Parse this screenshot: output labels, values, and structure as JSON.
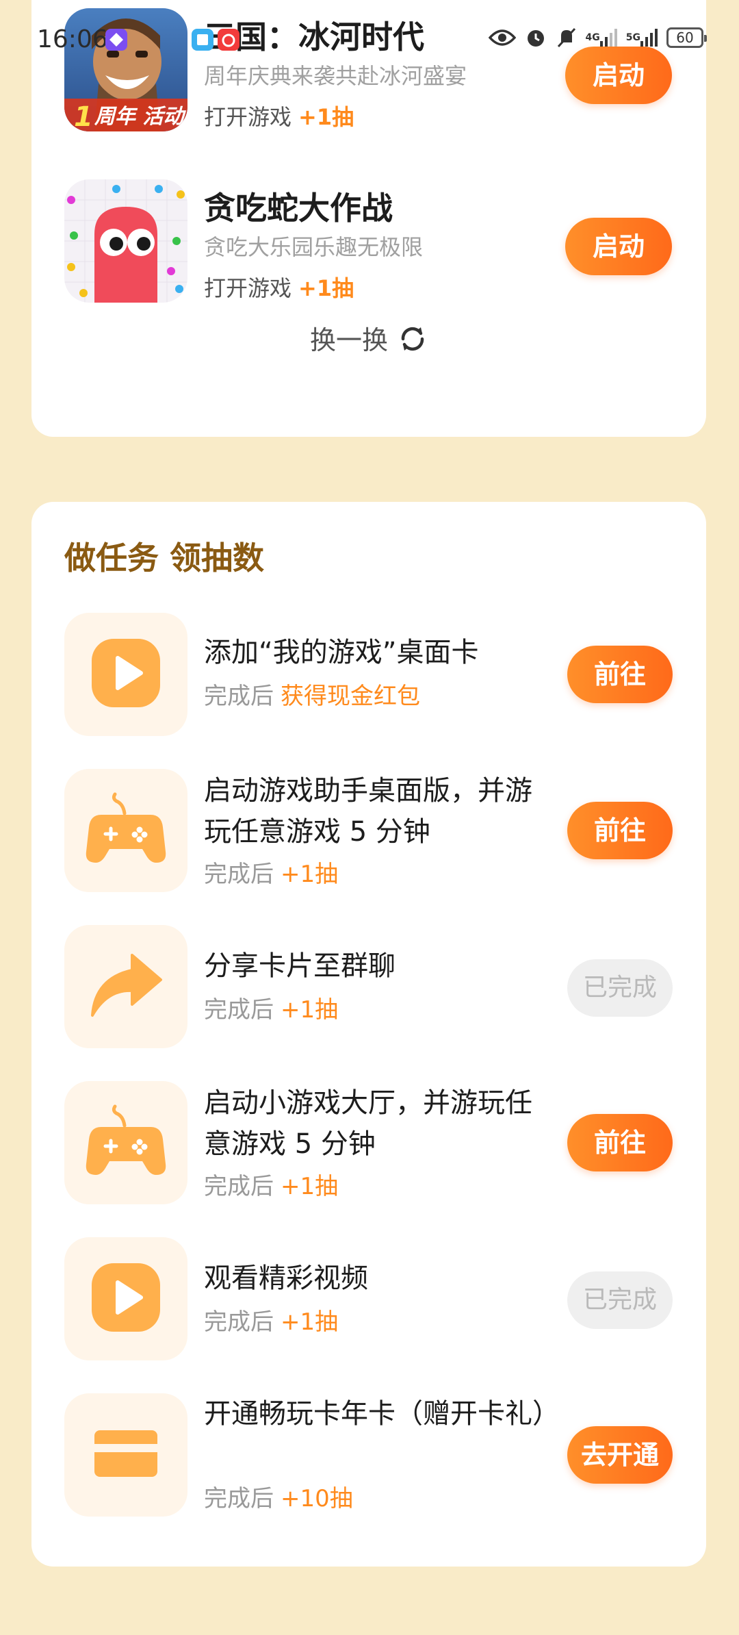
{
  "status_bar": {
    "time": "16:06",
    "network_1": "4G",
    "network_2": "5G",
    "battery": "60"
  },
  "games": [
    {
      "title": "三国：冰河时代",
      "subtitle": "周年庆典来袭共赴冰河盛宴",
      "action": "打开游戏",
      "reward": "+1抽",
      "button": "启动",
      "icon_badge": "1周年 活动"
    },
    {
      "title": "贪吃蛇大作战",
      "subtitle": "贪吃大乐园乐趣无极限",
      "action": "打开游戏",
      "reward": "+1抽",
      "button": "启动"
    }
  ],
  "refresh_label": "换一换",
  "tasks_section": {
    "title": "做任务 领抽数",
    "reward_prefix": "完成后",
    "items": [
      {
        "icon": "play-icon",
        "title": "添加“我的游戏”桌面卡",
        "reward": "获得现金红包",
        "button": "前往",
        "done": false
      },
      {
        "icon": "gamepad-icon",
        "title": "启动游戏助手桌面版，并游玩任意游戏 5 分钟",
        "reward": "+1抽",
        "button": "前往",
        "done": false
      },
      {
        "icon": "share-icon",
        "title": "分享卡片至群聊",
        "reward": "+1抽",
        "button": "已完成",
        "done": true
      },
      {
        "icon": "gamepad-icon",
        "title": "启动小游戏大厅，并游玩任意游戏 5 分钟",
        "reward": "+1抽",
        "button": "前往",
        "done": false
      },
      {
        "icon": "play-icon",
        "title": "观看精彩视频",
        "reward": "+1抽",
        "button": "已完成",
        "done": true
      },
      {
        "icon": "card-icon",
        "title": "开通畅玩卡年卡（赠开卡礼）",
        "reward": "+10抽",
        "button": "去开通",
        "done": false
      }
    ]
  },
  "colors": {
    "page_bg": "#f9ebc8",
    "accent_orange": "#ff7a1f",
    "section_title": "#8a5a12",
    "icon_orange": "#ffb04c"
  }
}
